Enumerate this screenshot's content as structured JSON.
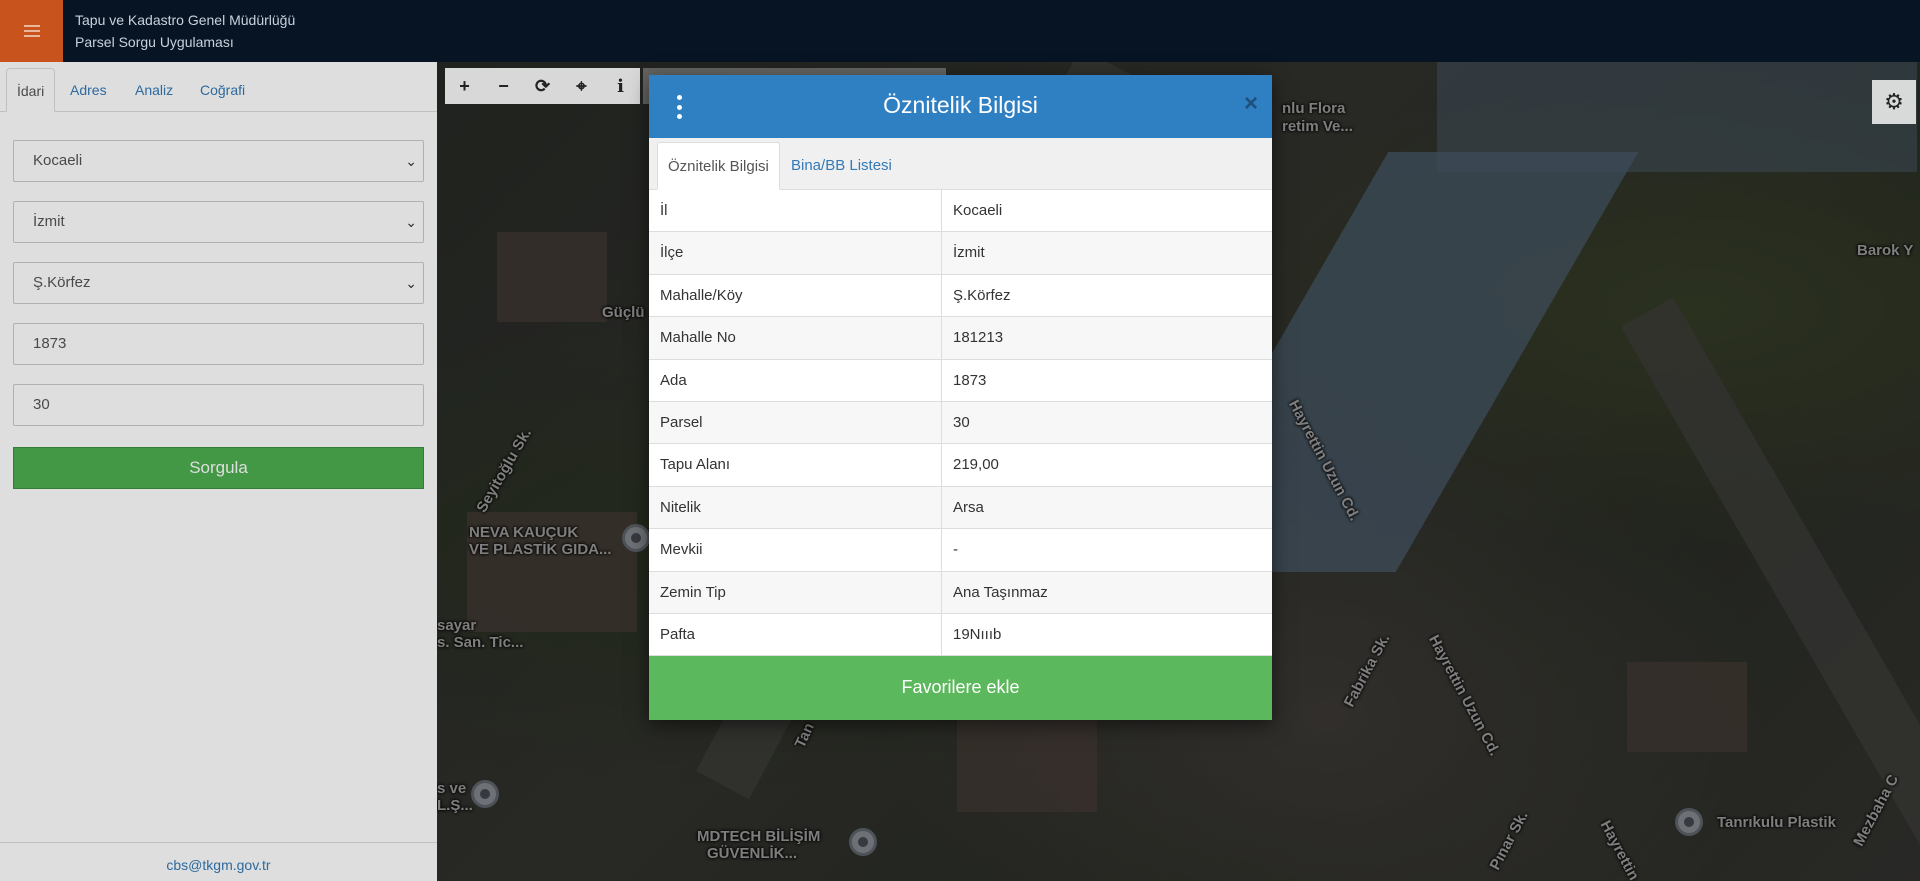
{
  "header": {
    "title_line1": "Tapu ve Kadastro Genel Müdürlüğü",
    "title_line2": "Parsel Sorgu Uygulaması",
    "menu_icon": "hamburger-icon"
  },
  "sidebar": {
    "tabs": [
      "İdari",
      "Adres",
      "Analiz",
      "Coğrafi"
    ],
    "active_tab": "İdari",
    "fields": {
      "il": "Kocaeli",
      "ilce": "İzmit",
      "mahalle": "Ş.Körfez",
      "ada": "1873",
      "parsel": "30"
    },
    "submit_label": "Sorgula",
    "footer_email": "cbs@tkgm.gov.tr"
  },
  "map": {
    "toolbar_icons": [
      "zoom-in-icon",
      "zoom-out-icon",
      "refresh-icon",
      "locate-icon",
      "info-icon"
    ],
    "labels": [
      "Güçlü",
      "Seyitoğlu Sk.",
      "NEVA KAUÇUK",
      "VE PLASTİK GIDA...",
      "sayar",
      "s. San. Tic...",
      "s ve",
      "L.Ş...",
      "MDTECH BİLİŞİM",
      "GÜVENLİK...",
      "Hayrettin Uzun Cd.",
      "Hayrettin Uzun Cd.",
      "Fabrika Sk.",
      "Pınar Sk.",
      "Hayrettin",
      "Mezbaha C",
      "Tanrıkulu Plastik",
      "Barok Y",
      "nlu Flora",
      "retim Ve...",
      "Tan"
    ]
  },
  "modal": {
    "title": "Öznitelik Bilgisi",
    "tabs": [
      "Öznitelik Bilgisi",
      "Bina/BB Listesi"
    ],
    "rows": [
      {
        "key": "İl",
        "value": "Kocaeli"
      },
      {
        "key": "İlçe",
        "value": "İzmit"
      },
      {
        "key": "Mahalle/Köy",
        "value": "Ş.Körfez"
      },
      {
        "key": "Mahalle No",
        "value": "181213"
      },
      {
        "key": "Ada",
        "value": "1873"
      },
      {
        "key": "Parsel",
        "value": "30"
      },
      {
        "key": "Tapu Alanı",
        "value": "219,00"
      },
      {
        "key": "Nitelik",
        "value": "Arsa"
      },
      {
        "key": "Mevkii",
        "value": "-"
      },
      {
        "key": "Zemin Tip",
        "value": "Ana Taşınmaz"
      },
      {
        "key": "Pafta",
        "value": "19Nıııb"
      }
    ],
    "favorite_label": "Favorilere ekle",
    "close_symbol": "×"
  }
}
